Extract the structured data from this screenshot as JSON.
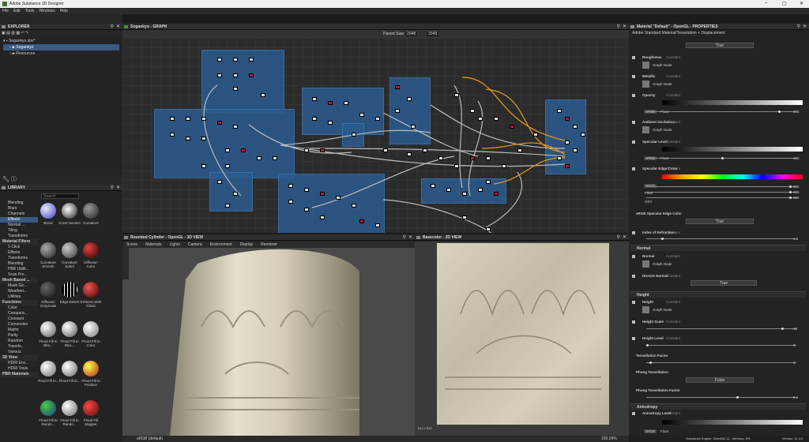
{
  "app": {
    "title": "Adobe Substance 3D Designer",
    "menu": [
      "File",
      "Edit",
      "Tools",
      "Windows",
      "Help"
    ]
  },
  "explorer": {
    "title": "EXPLORER",
    "items": [
      "Sogankyo.sbs*",
      "Sogankyo",
      "Resources"
    ]
  },
  "graph": {
    "title": "Sogankyo - GRAPH",
    "parent_size_label": "Parent Size:",
    "parent_size_w": "2048",
    "parent_size_h": "2048"
  },
  "library": {
    "title": "LIBRARY",
    "search_placeholder": "Search",
    "categories": [
      "Blending",
      "Blurs",
      "Channels",
      "Effects",
      "Normal ...",
      "Tiling",
      "Transforms",
      "Material Filters",
      "1-Click",
      "Effects",
      "Transforms",
      "Blending",
      "PBR Utiliti...",
      "Scan Pro...",
      "Mesh Based ...",
      "Mask Ge...",
      "Weatheri...",
      "Utilities",
      "Functions",
      "Color",
      "Comparis...",
      "Constant",
      "Conversion",
      "Maths",
      "Parity",
      "Random",
      "Transfo...",
      "Various",
      "3D View",
      "HDRI Env...",
      "HDRI Tools",
      "PBR Materials"
    ],
    "thumbs": [
      "Bevel",
      "Cross Section",
      "Curvature",
      "Curvature Smooth",
      "Curvature Sobel",
      "Diffusion Color",
      "Diffusion Grayscale",
      "Edge Detect",
      "Emboss With Gloss",
      "Flood Fill to Bbo...",
      "Flood Fill to Bbo...",
      "Flood Fill to Color",
      "Flood Fill to...",
      "Flood Fill to...",
      "Flood Fill to Position",
      "Flood Fill to Rando...",
      "Flood Fill to Rando...",
      "Flood Fill Mapper"
    ]
  },
  "view3d": {
    "title": "Rounded Cylinder - OpenGL - 3D VIEW",
    "menu": [
      "Scene",
      "Materials",
      "Lights",
      "Camera",
      "Environment",
      "Display",
      "Renderer"
    ],
    "colorspace": "sRGB (default)"
  },
  "view2d": {
    "title": "Basecolor - 2D VIEW",
    "resolution": "512 x 512",
    "zoom": "100.29%"
  },
  "properties": {
    "title": "Material \"Default\" - OpenGL - PROPERTIES",
    "breadcrumb": "Adobe Standard Material/Tesselation + Displacement",
    "true_label": "True",
    "false_label": "False",
    "roughness": "Roughness",
    "metallic": "Metallic",
    "opacity": "Opacity",
    "ao": "Ambient Occlusion",
    "spec_level": "Specular Level",
    "spec_edge": "Specular Edge Color",
    "srgb_spec": "sRGB Specular Edge Color",
    "ior": "Index of Refraction",
    "normal_sect": "Normal",
    "normal": "Normal",
    "directx": "DirectX Normal",
    "height_sect": "Height",
    "height": "Height",
    "height_scale": "Height Scale",
    "height_level": "Height Level",
    "tess": "Tessellation Factor",
    "phong": "Phong Tessellation",
    "phong_factor": "Phong Tessellation Factor",
    "aniso_sect": "Anisotropy",
    "aniso": "Anisotropy Level",
    "constant": "Constant",
    "graph_node": "Graph Node",
    "srgb": "sRGB",
    "float": "Float",
    "hsv": "HSV",
    "v_opacity": "255",
    "v_spec": "128",
    "v_r": "255",
    "v_g": "255",
    "v_b": "255",
    "v_ior": "1.5",
    "v_hscale": "18",
    "v_hlevel": "0",
    "v_tess": "1",
    "v_phong": "0.6",
    "v_aniso": "0",
    "v_1": "1"
  },
  "status": {
    "engine": "Substance Engine: Direct3D 11 - Memory: 0%",
    "version": "Version: 11.3.2"
  }
}
